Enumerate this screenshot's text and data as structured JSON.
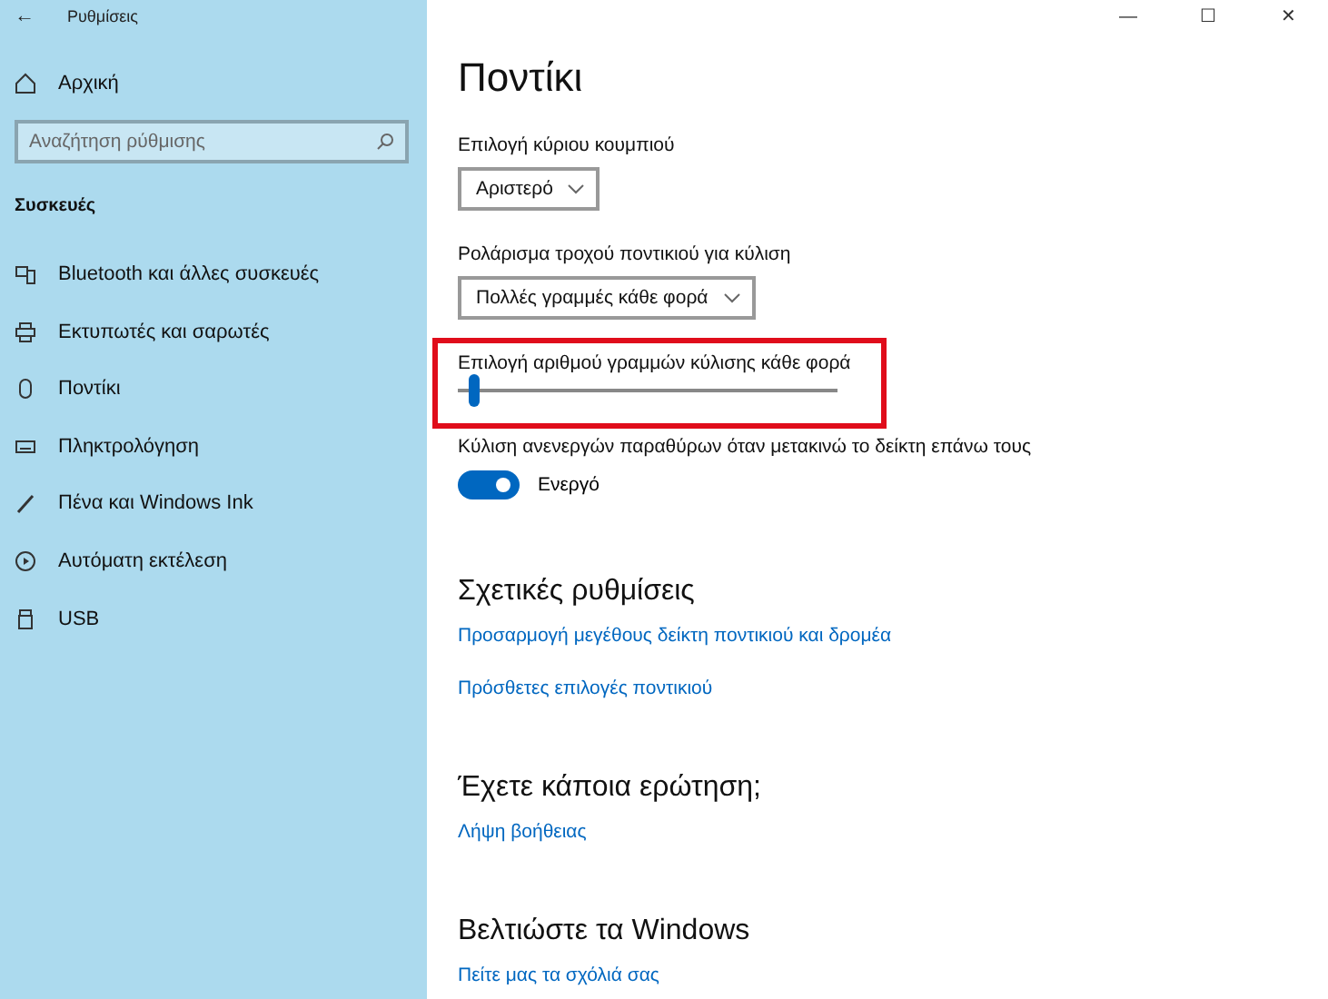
{
  "window": {
    "title": "Ρυθμίσεις",
    "back": "←",
    "controls": [
      "—",
      "☐",
      "✕"
    ]
  },
  "sidebar": {
    "home": "Αρχική",
    "search": {
      "placeholder": "Αναζήτηση ρύθμισης"
    },
    "section": "Συσκευές",
    "items": [
      {
        "label": "Bluetooth και άλλες συσκευές",
        "kind": "bluetooth"
      },
      {
        "label": "Εκτυπωτές και σαρωτές",
        "kind": "printer"
      },
      {
        "label": "Ποντίκι",
        "kind": "mouse"
      },
      {
        "label": "Πληκτρολόγηση",
        "kind": "keyboard"
      },
      {
        "label": "Πένα και Windows Ink",
        "kind": "pen"
      },
      {
        "label": "Αυτόματη εκτέλεση",
        "kind": "autoplay"
      },
      {
        "label": "USB",
        "kind": "usb"
      }
    ]
  },
  "page": {
    "title": "Ποντίκι",
    "settings": [
      {
        "kind": "dropdown",
        "label": "Επιλογή κύριου κουμπιού",
        "value": "Αριστερό"
      },
      {
        "kind": "dropdown",
        "label": "Ρολάρισμα τροχού ποντικιού για κύλιση",
        "value": "Πολλές γραμμές κάθε φορά"
      },
      {
        "kind": "slider",
        "label": "Επιλογή αριθμού γραμμών κύλισης κάθε φορά",
        "level": 0.03,
        "highlighted": true
      },
      {
        "kind": "toggle",
        "label": "Κύλιση ανενεργών παραθύρων όταν μετακινώ το δείκτη επάνω τους",
        "on": true,
        "value": "Ενεργό"
      }
    ],
    "sections": [
      {
        "heading": "Σχετικές ρυθμίσεις",
        "links": [
          "Προσαρμογή μεγέθους δείκτη ποντικιού και δρομέα",
          "Πρόσθετες επιλογές ποντικιού"
        ]
      },
      {
        "heading": "Έχετε κάποια ερώτηση;",
        "links": [
          "Λήψη βοήθειας"
        ]
      },
      {
        "heading": "Βελτιώστε τα Windows",
        "links": [
          "Πείτε μας τα σχόλιά σας"
        ]
      }
    ]
  }
}
